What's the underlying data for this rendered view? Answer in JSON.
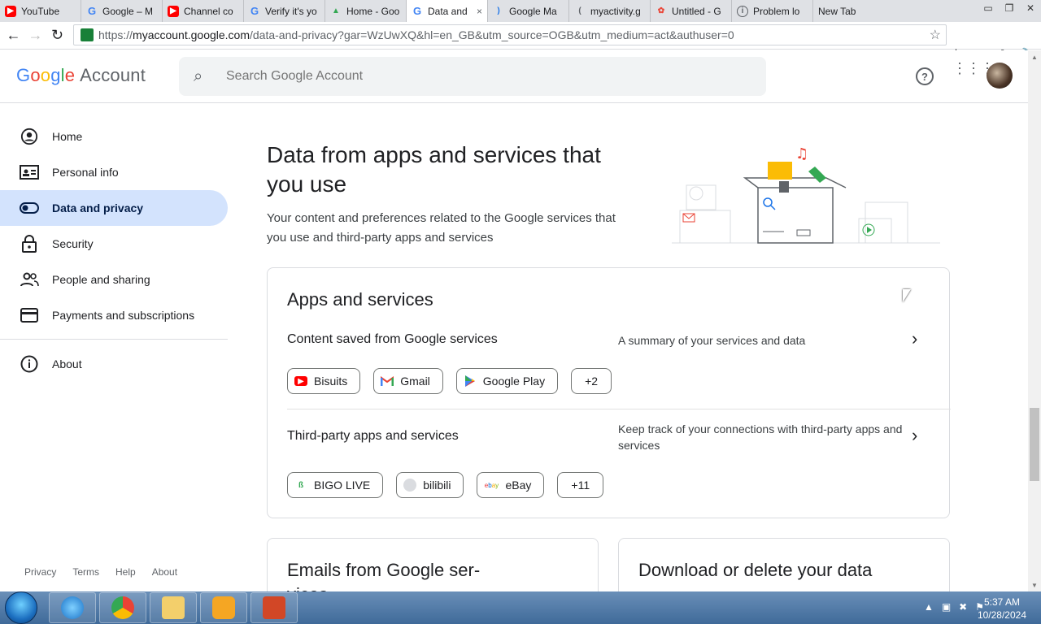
{
  "browser": {
    "tabs": [
      {
        "label": "YouTube",
        "favicon": "youtube-icon",
        "active": false
      },
      {
        "label": "Google – M",
        "favicon": "google-g-icon",
        "active": false
      },
      {
        "label": "Channel co",
        "favicon": "youtube-icon",
        "active": false
      },
      {
        "label": "Verify it's yo",
        "favicon": "google-g-icon",
        "active": false
      },
      {
        "label": "Home - Goo",
        "favicon": "drive-icon",
        "active": false
      },
      {
        "label": "Data and",
        "favicon": "google-g-icon",
        "active": true
      },
      {
        "label": "Google Ma",
        "favicon": "loading-icon",
        "active": false
      },
      {
        "label": "myactivity.g",
        "favicon": "loading-icon",
        "active": false
      },
      {
        "label": "Untitled - G",
        "favicon": "photos-icon",
        "active": false
      },
      {
        "label": "Problem lo",
        "favicon": "info-icon",
        "active": false
      },
      {
        "label": "New Tab",
        "favicon": "none",
        "active": false
      }
    ],
    "tab_close": "×",
    "url_prefix": "https://",
    "url_host": "myaccount.google.com",
    "url_path": "/data-and-privacy?gar=WzUwXQ&hl=en_GB&utm_source=OGB&utm_medium=act&authuser=0"
  },
  "header": {
    "logo_google": "Google",
    "logo_account": "Account",
    "search_placeholder": "Search Google Account"
  },
  "sidebar": {
    "items": [
      {
        "label": "Home",
        "icon": "account-circle-icon"
      },
      {
        "label": "Personal info",
        "icon": "id-card-icon"
      },
      {
        "label": "Data and privacy",
        "icon": "toggle-icon"
      },
      {
        "label": "Security",
        "icon": "lock-icon"
      },
      {
        "label": "People and sharing",
        "icon": "people-icon"
      },
      {
        "label": "Payments and subscriptions",
        "icon": "credit-card-icon"
      },
      {
        "label": "About",
        "icon": "info-icon"
      }
    ],
    "footer": [
      "Privacy",
      "Terms",
      "Help",
      "About"
    ]
  },
  "main": {
    "title": "Data from apps and services that you use",
    "subtitle": "Your content and preferences related to the Google services that you use and third-party apps and services",
    "card": {
      "title": "Apps and services",
      "rows": [
        {
          "title": "Content saved from Google services",
          "desc": "A summary of your services and data",
          "chips": [
            {
              "label": "Bisuits",
              "icon": "youtube-icon"
            },
            {
              "label": "Gmail",
              "icon": "gmail-icon"
            },
            {
              "label": "Google Play",
              "icon": "google-play-icon"
            },
            {
              "label": "+2",
              "icon": "none"
            }
          ]
        },
        {
          "title": "Third-party apps and services",
          "desc": "Keep track of your connections with third-party apps and services",
          "chips": [
            {
              "label": "BIGO LIVE",
              "icon": "bigo-live-icon"
            },
            {
              "label": "bilibili",
              "icon": "bilibili-icon"
            },
            {
              "label": "eBay",
              "icon": "ebay-icon"
            },
            {
              "label": "+11",
              "icon": "none"
            }
          ]
        }
      ]
    },
    "bottom_cards": [
      {
        "title": "Emails from Google ser-vices"
      },
      {
        "title": "Download or delete your data"
      }
    ]
  },
  "taskbar": {
    "time": "5:37 AM",
    "date": "10/28/2024"
  }
}
